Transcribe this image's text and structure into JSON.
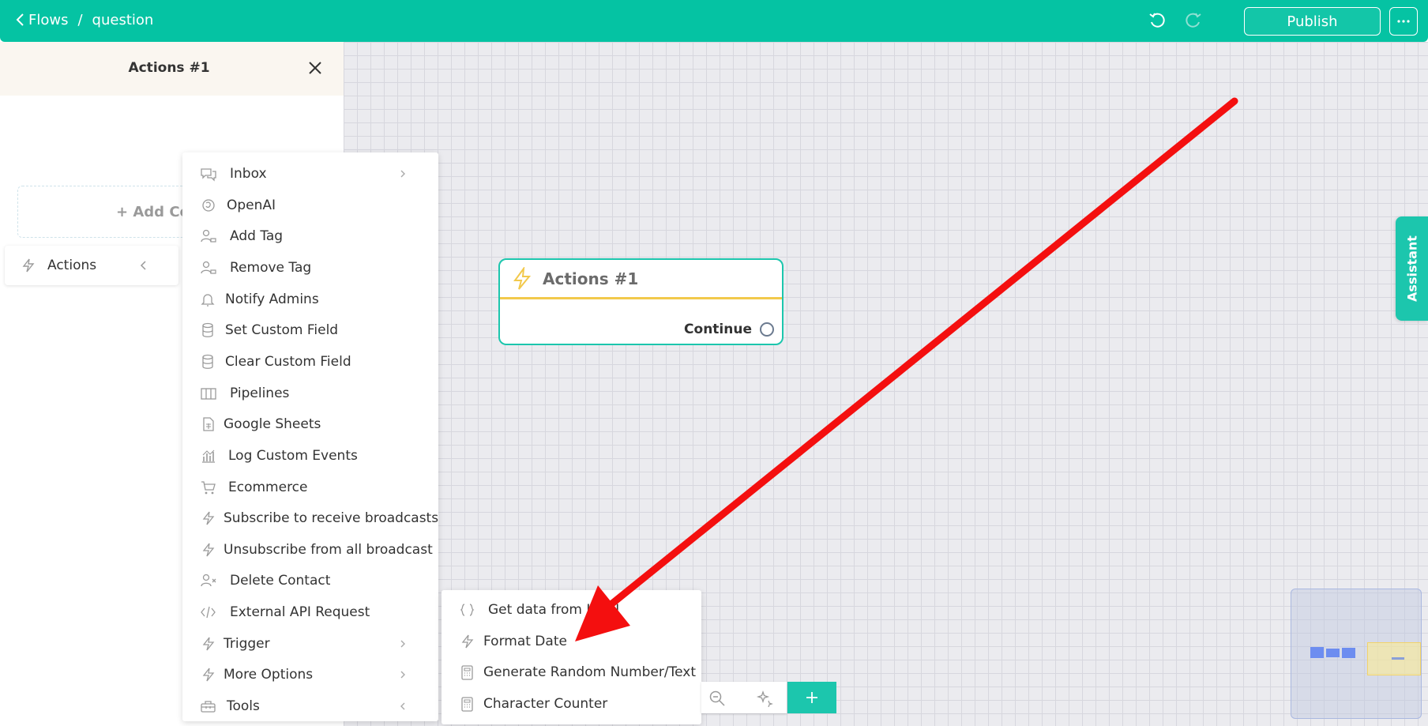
{
  "header": {
    "back_label": "Flows",
    "separator": "/",
    "flow_name": "question",
    "publish_label": "Publish"
  },
  "panel": {
    "title": "Actions #1",
    "add_condition_label": "+ Add Co",
    "actions_label": "Actions"
  },
  "node": {
    "title": "Actions #1",
    "continue_label": "Continue"
  },
  "action_menu": {
    "items": [
      {
        "label": "Inbox",
        "icon": "chat-icon",
        "has_submenu": true
      },
      {
        "label": "OpenAI",
        "icon": "openai-icon",
        "has_submenu": false
      },
      {
        "label": "Add Tag",
        "icon": "user-tag-icon",
        "has_submenu": false
      },
      {
        "label": "Remove Tag",
        "icon": "user-tag-icon",
        "has_submenu": false
      },
      {
        "label": "Notify Admins",
        "icon": "bell-icon",
        "has_submenu": false
      },
      {
        "label": "Set Custom Field",
        "icon": "database-icon",
        "has_submenu": false
      },
      {
        "label": "Clear Custom Field",
        "icon": "database-icon",
        "has_submenu": false
      },
      {
        "label": "Pipelines",
        "icon": "columns-icon",
        "has_submenu": false
      },
      {
        "label": "Google Sheets",
        "icon": "sheet-icon",
        "has_submenu": false
      },
      {
        "label": "Log Custom Events",
        "icon": "chart-icon",
        "has_submenu": false
      },
      {
        "label": "Ecommerce",
        "icon": "cart-icon",
        "has_submenu": false
      },
      {
        "label": "Subscribe to receive broadcasts",
        "icon": "bolt-icon",
        "has_submenu": false
      },
      {
        "label": "Unsubscribe from all broadcast",
        "icon": "bolt-icon",
        "has_submenu": false
      },
      {
        "label": "Delete Contact",
        "icon": "user-x-icon",
        "has_submenu": false
      },
      {
        "label": "External API Request",
        "icon": "code-icon",
        "has_submenu": false
      },
      {
        "label": "Trigger",
        "icon": "bolt-icon",
        "has_submenu": true
      },
      {
        "label": "More Options",
        "icon": "bolt-icon",
        "has_submenu": true
      },
      {
        "label": "Tools",
        "icon": "toolbox-icon",
        "has_submenu": true,
        "open": true
      }
    ]
  },
  "tools_submenu": {
    "items": [
      {
        "label": "Get data from JSON",
        "icon": "braces-icon"
      },
      {
        "label": "Format Date",
        "icon": "bolt-icon"
      },
      {
        "label": "Generate Random Number/Text",
        "icon": "calculator-icon"
      },
      {
        "label": "Character Counter",
        "icon": "calculator-icon"
      }
    ]
  },
  "assistant_label": "Assistant",
  "colors": {
    "brand": "#05c3a3",
    "node_border": "#1cc6ad",
    "node_divider": "#f2c94c",
    "annotation_arrow": "#f40f0f"
  }
}
